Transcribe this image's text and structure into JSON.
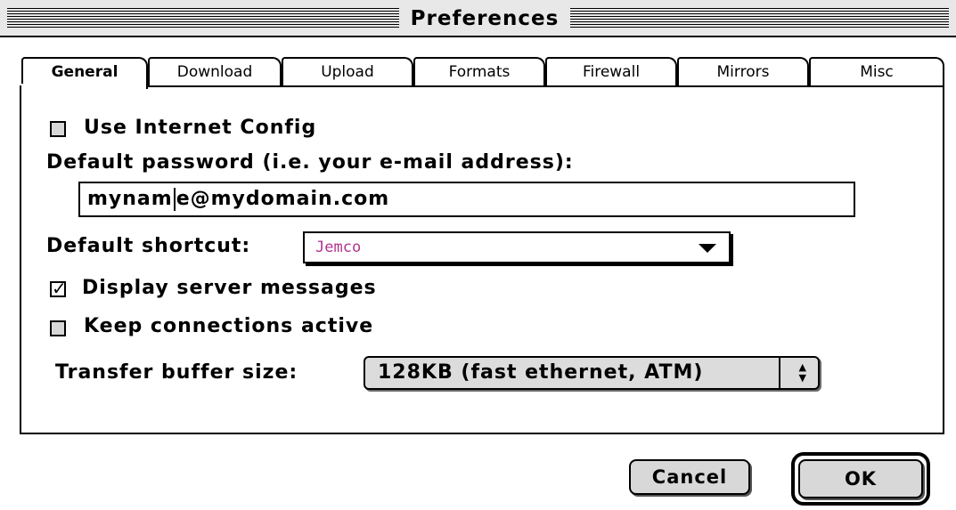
{
  "window": {
    "title": "Preferences"
  },
  "tabs": [
    {
      "label": "General",
      "active": true
    },
    {
      "label": "Download",
      "active": false
    },
    {
      "label": "Upload",
      "active": false
    },
    {
      "label": "Formats",
      "active": false
    },
    {
      "label": "Firewall",
      "active": false
    },
    {
      "label": "Mirrors",
      "active": false
    },
    {
      "label": "Misc",
      "active": false
    }
  ],
  "general": {
    "use_internet_config": {
      "label": "Use Internet Config",
      "checked": false
    },
    "password": {
      "label": "Default password (i.e. your e-mail address):",
      "value_before_caret": "mynam",
      "value_after_caret": "e@mydomain.com"
    },
    "shortcut": {
      "label": "Default shortcut:",
      "value": "Jemco",
      "color": "#b0358f"
    },
    "display_server_messages": {
      "label": "Display server messages",
      "checked": true
    },
    "keep_connections_active": {
      "label": "Keep connections active",
      "checked": false
    },
    "buffer": {
      "label": "Transfer buffer size:",
      "value": "128KB (fast ethernet, ATM)"
    }
  },
  "buttons": {
    "cancel": "Cancel",
    "ok": "OK"
  },
  "icons": {
    "popup_arrow": "triangle-down-icon",
    "select_arrows": "up-down-arrows-icon",
    "check": "checkmark-icon"
  }
}
